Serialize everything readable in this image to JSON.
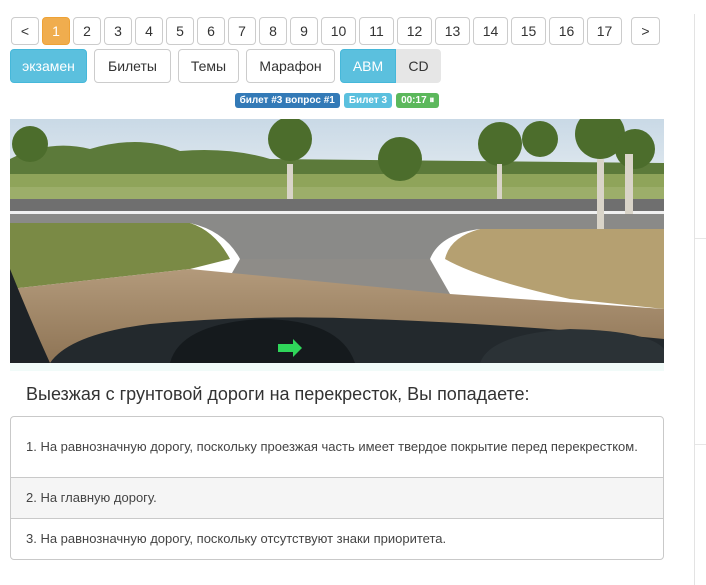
{
  "pagination": {
    "prev_label": "<",
    "next_label": ">",
    "pages": [
      "1",
      "2",
      "3",
      "4",
      "5",
      "6",
      "7",
      "8",
      "9",
      "10",
      "11",
      "12",
      "13",
      "14",
      "15",
      "16",
      "17"
    ],
    "active_page": "1"
  },
  "modes": {
    "exam_label": "экзамен",
    "tickets_label": "Билеты",
    "topics_label": "Темы",
    "marathon_label": "Марафон",
    "category_abm_label": "ABM",
    "category_cd_label": "CD"
  },
  "badges": {
    "ticket_question": "билет #3 вопрос #1",
    "ticket": "Билет 3",
    "timer": "00:17 ⏸"
  },
  "colors": {
    "active_page": "#f0ad4e",
    "info": "#5bc0de",
    "primary": "#337ab7",
    "success": "#5cb85c"
  },
  "question": {
    "text": "Выезжая с грунтовой дороги на перекресток, Вы попадаете:"
  },
  "answers": [
    "1. На равнозначную дорогу, поскольку проезжая часть имеет твердое покрытие перед перекрестком.",
    "2. На главную дорогу.",
    "3. На равнозначную дорогу, поскольку отсутствуют знаки приоритета."
  ]
}
